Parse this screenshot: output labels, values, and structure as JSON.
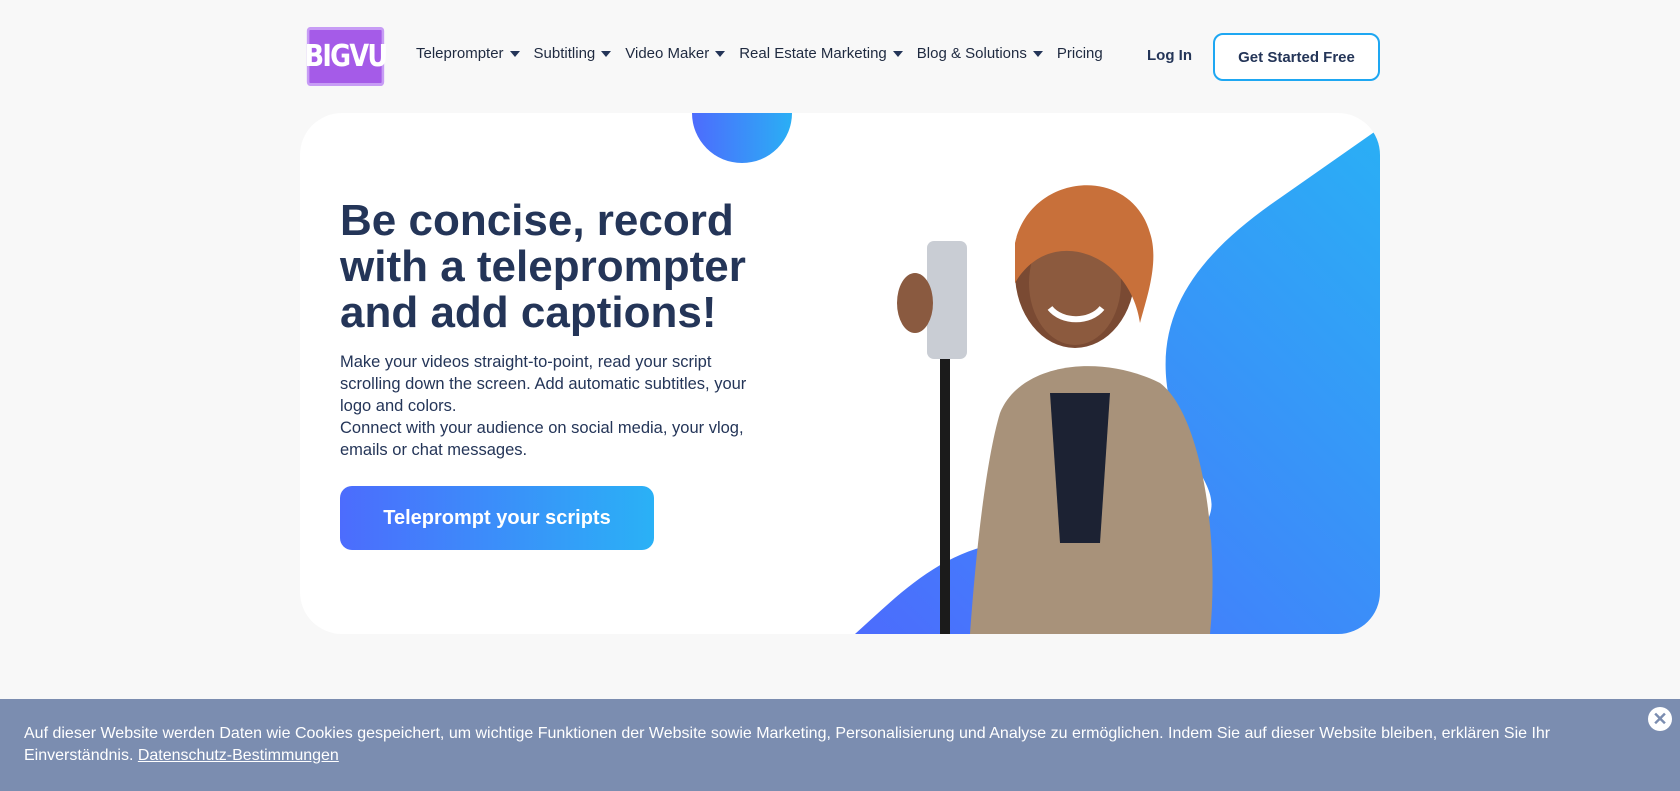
{
  "header": {
    "logo": "BIGVU",
    "nav": [
      {
        "label": "Teleprompter",
        "dropdown": true
      },
      {
        "label": "Subtitling",
        "dropdown": true
      },
      {
        "label": "Video Maker",
        "dropdown": true
      },
      {
        "label": "Real Estate Marketing",
        "dropdown": true
      },
      {
        "label": "Blog & Solutions",
        "dropdown": true
      },
      {
        "label": "Pricing",
        "dropdown": false
      }
    ],
    "login": "Log In",
    "get_started": "Get Started Free"
  },
  "hero": {
    "title": "Be concise, record with a teleprompter and add captions!",
    "para1": "Make your videos straight-to-point, read your script scrolling down the screen. Add automatic subtitles, your logo and colors.",
    "para2": "Connect with your audience on social media, your vlog, emails or chat messages.",
    "button": "Teleprompt your scripts",
    "colors": {
      "gradient_start": "#4c6cfd",
      "gradient_end": "#2ab1f6",
      "text": "#243558"
    }
  },
  "cookie": {
    "text": "Auf dieser Website werden Daten wie Cookies gespeichert, um wichtige Funktionen der Website sowie Marketing, Personalisierung und Analyse zu ermöglichen. Indem Sie auf dieser Website bleiben, erklären Sie Ihr Einverständnis.",
    "link": "Datenschutz-Bestimmungen",
    "close_icon": "close-icon",
    "background": "#7b8db0"
  }
}
